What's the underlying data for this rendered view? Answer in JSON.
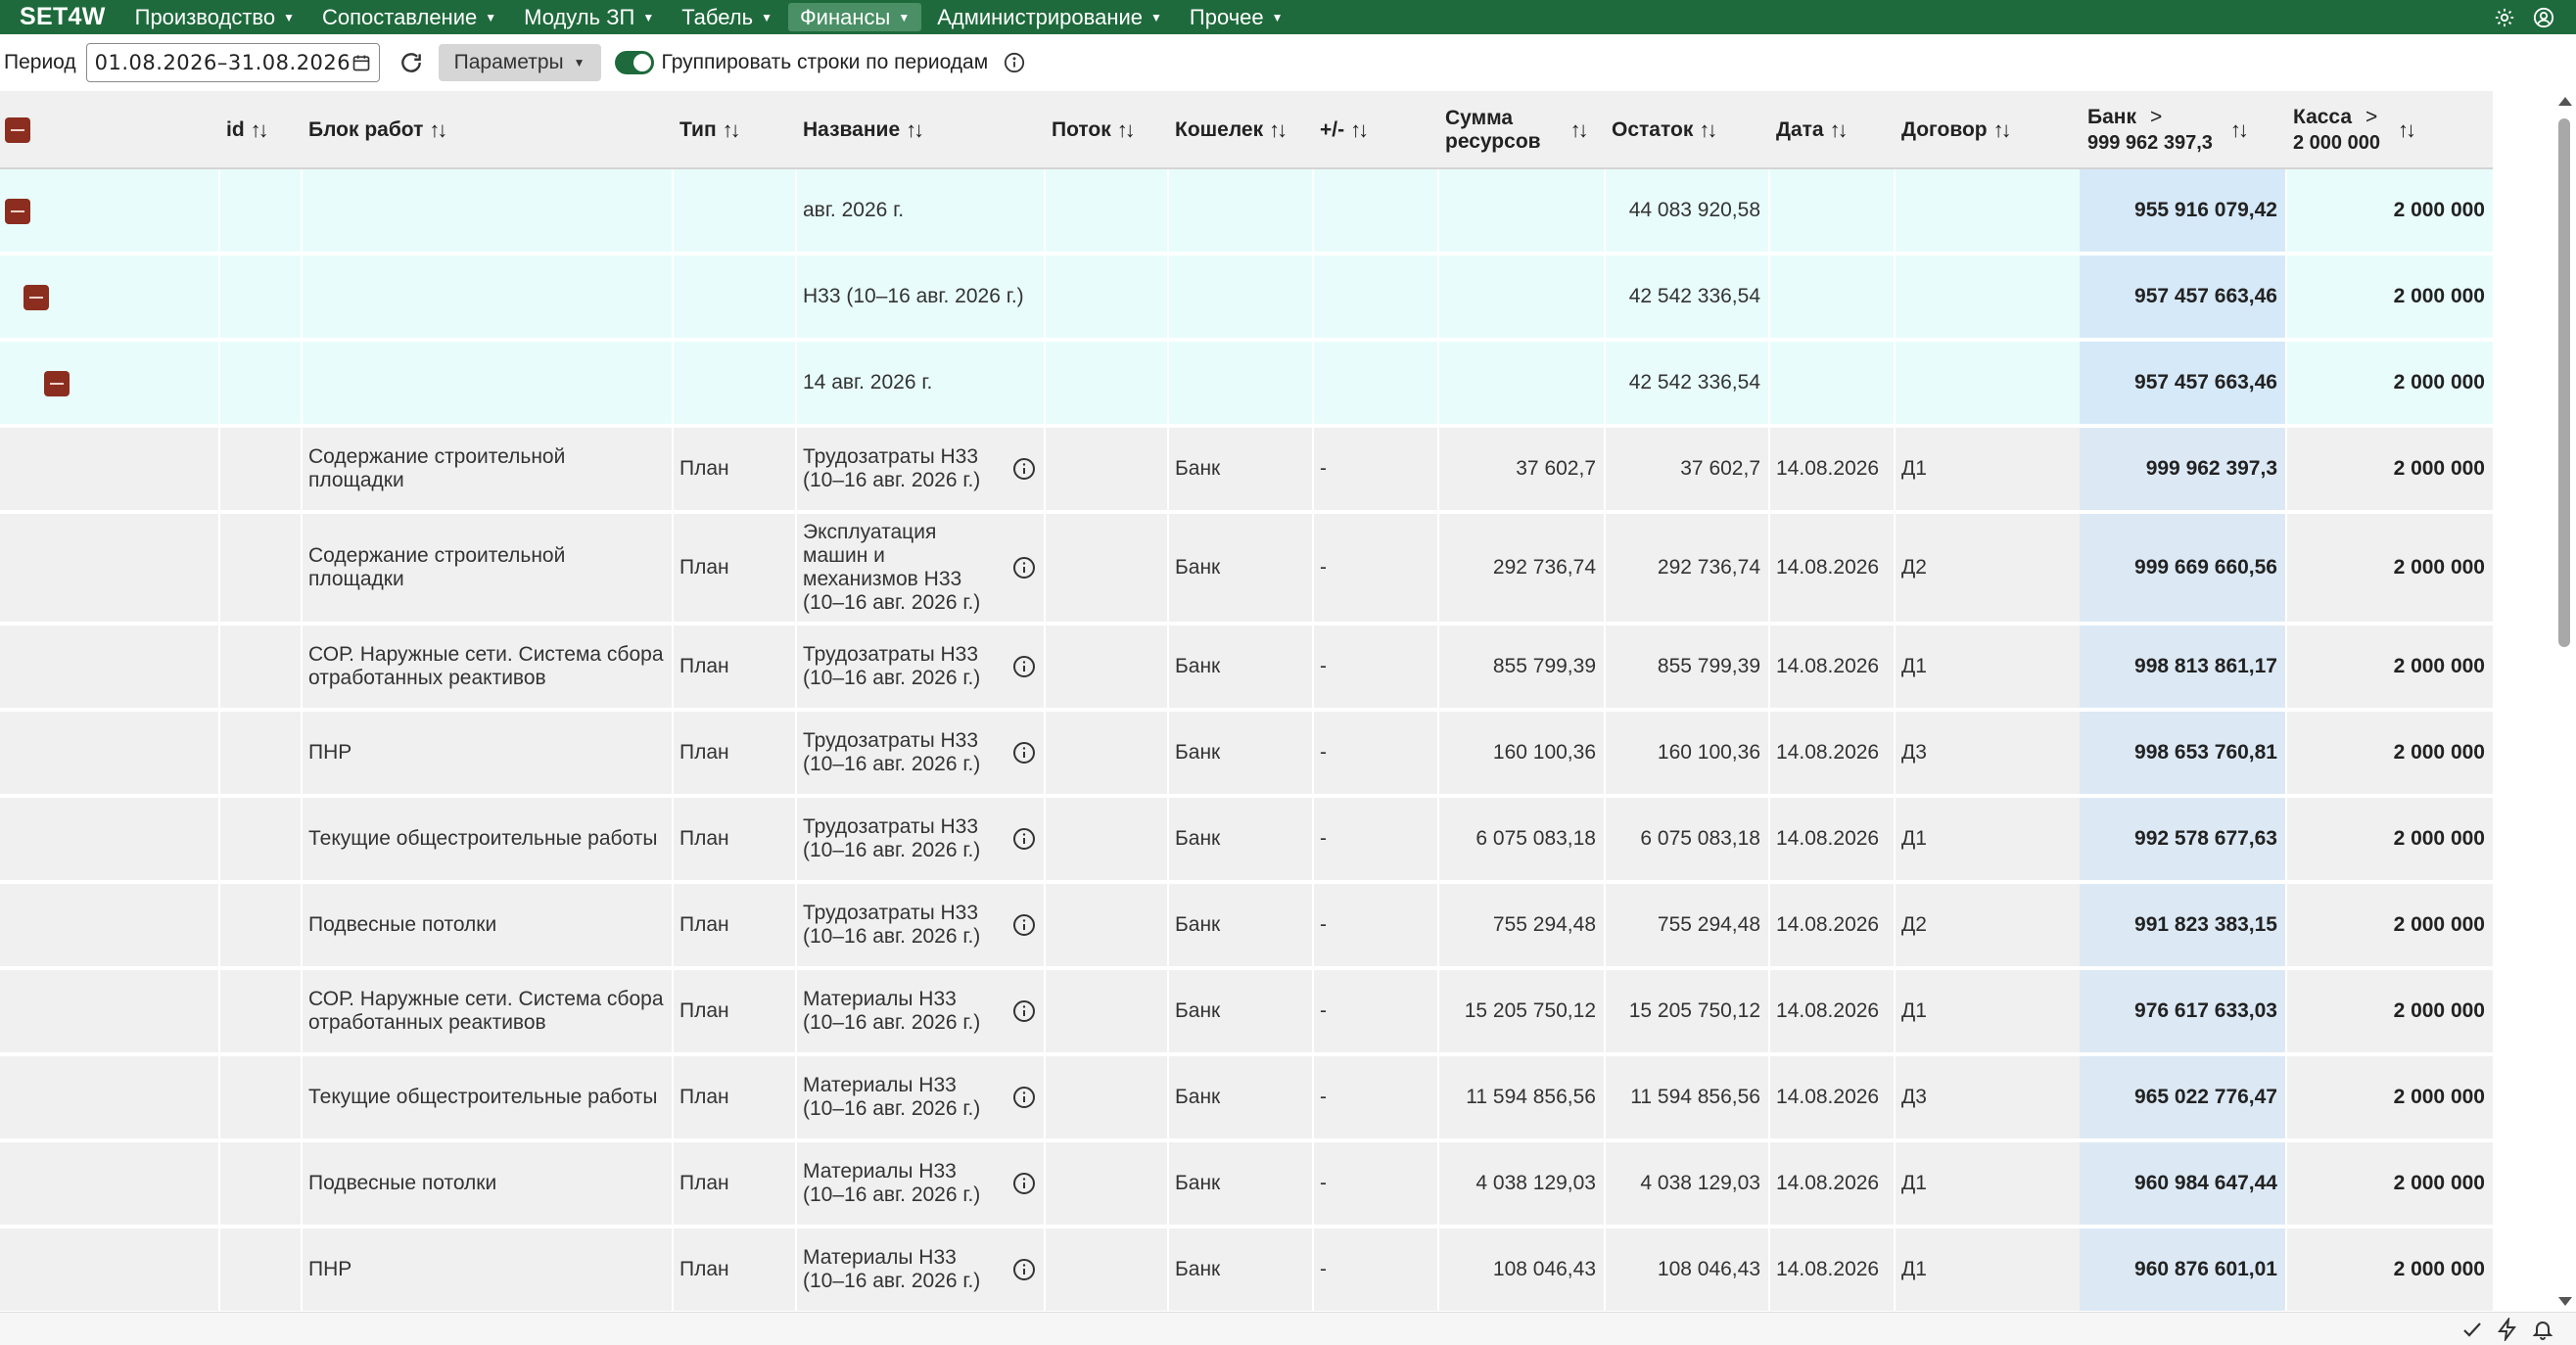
{
  "app": {
    "brand": "SET4W",
    "menu": [
      {
        "label": "Производство"
      },
      {
        "label": "Сопоставление"
      },
      {
        "label": "Модуль ЗП"
      },
      {
        "label": "Табель"
      },
      {
        "label": "Финансы",
        "active": true
      },
      {
        "label": "Администрирование"
      },
      {
        "label": "Прочее"
      }
    ],
    "right_icons": [
      "gear-icon",
      "user-circle-icon"
    ]
  },
  "toolbar": {
    "period_label": "Период",
    "period_value": "01.08.2026–31.08.2026",
    "params_label": "Параметры",
    "group_toggle_on": true,
    "group_label": "Группировать строки по периодам"
  },
  "table": {
    "columns": {
      "id": "id",
      "block": "Блок работ",
      "type": "Тип",
      "name": "Название",
      "flow": "Поток",
      "wallet": "Кошелек",
      "plusminus": "+/-",
      "sum_l1": "Сумма",
      "sum_l2": "ресурсов",
      "rest": "Остаток",
      "date": "Дата",
      "contract": "Договор",
      "bank": "Банк",
      "bank_total": "999 962 397,3",
      "cash": "Касса",
      "cash_total": "2 000 000"
    },
    "groups": [
      {
        "name": "авг. 2026 г.",
        "rest": "44 083 920,58",
        "bank": "955 916 079,42",
        "cash": "2 000 000"
      },
      {
        "name": "Н33 (10–16 авг. 2026 г.)",
        "rest": "42 542 336,54",
        "bank": "957 457 663,46",
        "cash": "2 000 000"
      },
      {
        "name": "14 авг. 2026 г.",
        "rest": "42 542 336,54",
        "bank": "957 457 663,46",
        "cash": "2 000 000"
      }
    ],
    "rows": [
      {
        "block": [
          "Содержание строительной",
          "площадки"
        ],
        "type": "План",
        "name": [
          "Трудозатраты Н33",
          "(10–16 авг. 2026 г.)"
        ],
        "wallet": "Банк",
        "pm": "-",
        "sum": "37 602,7",
        "rest": "37 602,7",
        "date": "14.08.2026",
        "contract": "Д1",
        "bank": "999 962 397,3",
        "cash": "2 000 000"
      },
      {
        "block": [
          "Содержание строительной",
          "площадки"
        ],
        "type": "План",
        "name": [
          "Эксплуатация",
          "машин и",
          "механизмов Н33",
          "(10–16 авг. 2026 г.)"
        ],
        "wallet": "Банк",
        "pm": "-",
        "sum": "292 736,74",
        "rest": "292 736,74",
        "date": "14.08.2026",
        "contract": "Д2",
        "bank": "999 669 660,56",
        "cash": "2 000 000"
      },
      {
        "block": [
          "СОР. Наружные сети. Система сбора",
          "отработанных реактивов"
        ],
        "type": "План",
        "name": [
          "Трудозатраты Н33",
          "(10–16 авг. 2026 г.)"
        ],
        "wallet": "Банк",
        "pm": "-",
        "sum": "855 799,39",
        "rest": "855 799,39",
        "date": "14.08.2026",
        "contract": "Д1",
        "bank": "998 813 861,17",
        "cash": "2 000 000"
      },
      {
        "block": [
          "ПНР"
        ],
        "type": "План",
        "name": [
          "Трудозатраты Н33",
          "(10–16 авг. 2026 г.)"
        ],
        "wallet": "Банк",
        "pm": "-",
        "sum": "160 100,36",
        "rest": "160 100,36",
        "date": "14.08.2026",
        "contract": "Д3",
        "bank": "998 653 760,81",
        "cash": "2 000 000"
      },
      {
        "block": [
          "Текущие общестроительные работы"
        ],
        "type": "План",
        "name": [
          "Трудозатраты Н33",
          "(10–16 авг. 2026 г.)"
        ],
        "wallet": "Банк",
        "pm": "-",
        "sum": "6 075 083,18",
        "rest": "6 075 083,18",
        "date": "14.08.2026",
        "contract": "Д1",
        "bank": "992 578 677,63",
        "cash": "2 000 000"
      },
      {
        "block": [
          "Подвесные потолки"
        ],
        "type": "План",
        "name": [
          "Трудозатраты Н33",
          "(10–16 авг. 2026 г.)"
        ],
        "wallet": "Банк",
        "pm": "-",
        "sum": "755 294,48",
        "rest": "755 294,48",
        "date": "14.08.2026",
        "contract": "Д2",
        "bank": "991 823 383,15",
        "cash": "2 000 000"
      },
      {
        "block": [
          "СОР. Наружные сети. Система сбора",
          "отработанных реактивов"
        ],
        "type": "План",
        "name": [
          "Материалы Н33",
          "(10–16 авг. 2026 г.)"
        ],
        "wallet": "Банк",
        "pm": "-",
        "sum": "15 205 750,12",
        "rest": "15 205 750,12",
        "date": "14.08.2026",
        "contract": "Д1",
        "bank": "976 617 633,03",
        "cash": "2 000 000"
      },
      {
        "block": [
          "Текущие общестроительные работы"
        ],
        "type": "План",
        "name": [
          "Материалы Н33",
          "(10–16 авг. 2026 г.)"
        ],
        "wallet": "Банк",
        "pm": "-",
        "sum": "11 594 856,56",
        "rest": "11 594 856,56",
        "date": "14.08.2026",
        "contract": "Д3",
        "bank": "965 022 776,47",
        "cash": "2 000 000"
      },
      {
        "block": [
          "Подвесные потолки"
        ],
        "type": "План",
        "name": [
          "Материалы Н33",
          "(10–16 авг. 2026 г.)"
        ],
        "wallet": "Банк",
        "pm": "-",
        "sum": "4 038 129,03",
        "rest": "4 038 129,03",
        "date": "14.08.2026",
        "contract": "Д1",
        "bank": "960 984 647,44",
        "cash": "2 000 000"
      },
      {
        "block": [
          "ПНР"
        ],
        "type": "План",
        "name": [
          "Материалы Н33",
          "(10–16 авг. 2026 г.)"
        ],
        "wallet": "Банк",
        "pm": "-",
        "sum": "108 046,43",
        "rest": "108 046,43",
        "date": "14.08.2026",
        "contract": "Д1",
        "bank": "960 876 601,01",
        "cash": "2 000 000"
      }
    ]
  },
  "statusbar": {
    "icons": [
      "check-icon",
      "bolt-icon",
      "bell-icon"
    ]
  }
}
